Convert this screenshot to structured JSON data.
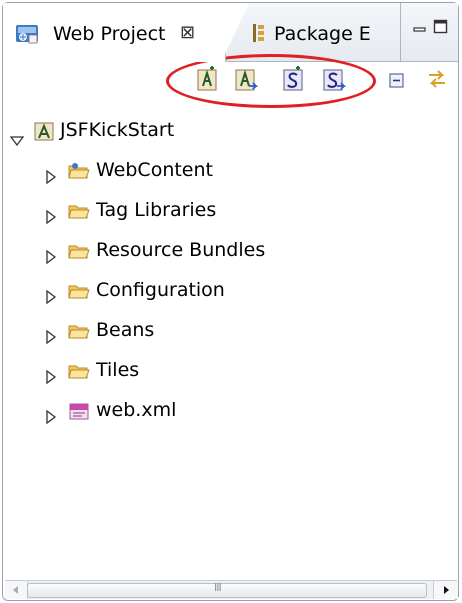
{
  "tabs": [
    {
      "label": "Web Project",
      "close_glyph": "⊠",
      "active": true,
      "icon": "web-project-icon"
    },
    {
      "label": "Package E",
      "active": false,
      "icon": "package-explorer-icon"
    }
  ],
  "toolbar": {
    "buttons": [
      "add-jsf-project-icon",
      "import-jsf-project-icon",
      "add-struts-project-icon",
      "import-struts-project-icon",
      "collapse-all-icon",
      "link-with-editor-icon"
    ],
    "highlight_color": "#e02020"
  },
  "tree": {
    "root": {
      "label": "JSFKickStart",
      "expanded": true,
      "icon": "jsf-project-icon"
    },
    "children": [
      {
        "label": "WebContent",
        "icon": "web-content-folder-icon"
      },
      {
        "label": "Tag Libraries",
        "icon": "folder-icon"
      },
      {
        "label": "Resource Bundles",
        "icon": "folder-icon"
      },
      {
        "label": "Configuration",
        "icon": "folder-icon"
      },
      {
        "label": "Beans",
        "icon": "folder-icon"
      },
      {
        "label": "Tiles",
        "icon": "folder-icon"
      },
      {
        "label": "web.xml",
        "icon": "xml-file-icon"
      }
    ]
  },
  "scrollbar": {
    "grip": "III"
  }
}
